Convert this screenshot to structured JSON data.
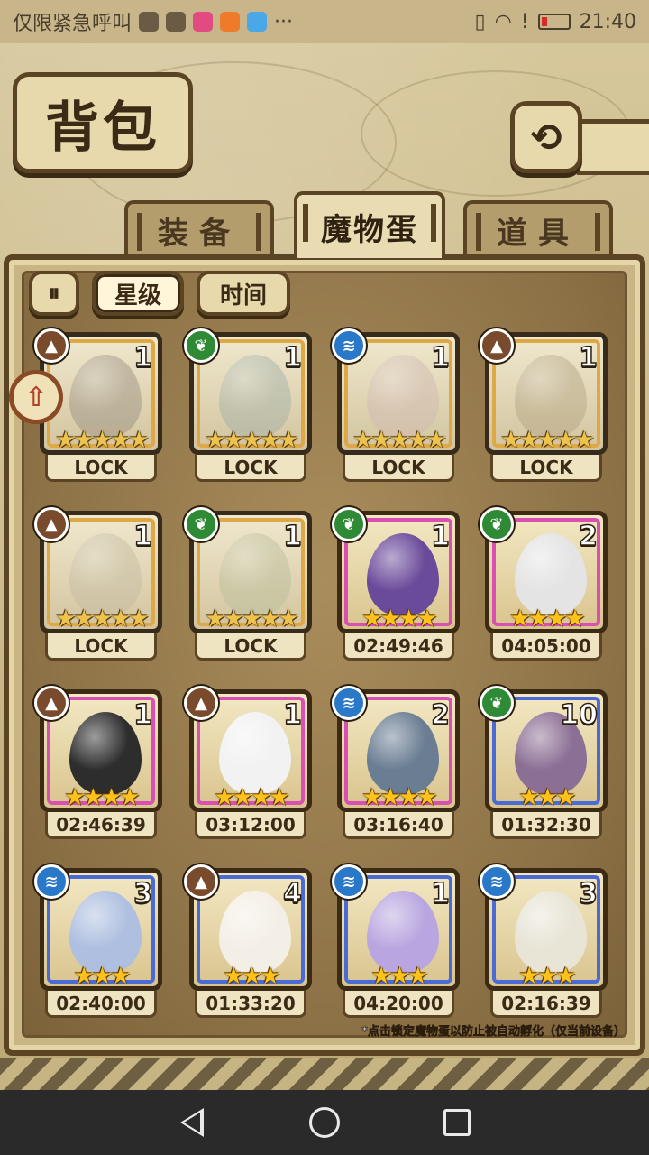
{
  "status_bar": {
    "carrier": "仅限紧急呼叫",
    "time": "21:40"
  },
  "header": {
    "title": "背包",
    "back_icon": "back-arrow-icon"
  },
  "tabs": [
    {
      "label": "装备",
      "active": false
    },
    {
      "label": "魔物蛋",
      "active": true
    },
    {
      "label": "道具",
      "active": false
    }
  ],
  "sort": {
    "toggle_icon": "pause-icon",
    "star_label": "星级",
    "time_label": "时间"
  },
  "eggs": [
    {
      "element": "earth",
      "count": "1",
      "stars": "★★★★★",
      "label": "LOCK",
      "rarity": "#f3a61c",
      "color": "#9a8c7a",
      "locked": true
    },
    {
      "element": "grass",
      "count": "1",
      "stars": "★★★★★",
      "label": "LOCK",
      "rarity": "#f3a61c",
      "color": "#9bb2a8",
      "locked": true
    },
    {
      "element": "water",
      "count": "1",
      "stars": "★★★★★",
      "label": "LOCK",
      "rarity": "#f3a61c",
      "color": "#d8b6b0",
      "locked": true
    },
    {
      "element": "earth",
      "count": "1",
      "stars": "★★★★★",
      "label": "LOCK",
      "rarity": "#f3a61c",
      "color": "#b9a477",
      "locked": true
    },
    {
      "element": "earth",
      "count": "1",
      "stars": "★★★★★",
      "label": "LOCK",
      "rarity": "#f3a61c",
      "color": "#c7bb98",
      "locked": true
    },
    {
      "element": "grass",
      "count": "1",
      "stars": "★★★★★",
      "label": "LOCK",
      "rarity": "#f3a61c",
      "color": "#b7c08e",
      "locked": true
    },
    {
      "element": "grass",
      "count": "1",
      "stars": "★★★★",
      "label": "02:49:46",
      "rarity": "#d94fb2",
      "color": "#6a4a9a",
      "locked": false
    },
    {
      "element": "grass",
      "count": "2",
      "stars": "★★★★",
      "label": "04:05:00",
      "rarity": "#d94fb2",
      "color": "#e4e4e4",
      "locked": false
    },
    {
      "element": "earth",
      "count": "1",
      "stars": "★★★★",
      "label": "02:46:39",
      "rarity": "#d94fb2",
      "color": "#2d2d2d",
      "locked": false
    },
    {
      "element": "earth",
      "count": "1",
      "stars": "★★★★",
      "label": "03:12:00",
      "rarity": "#d94fb2",
      "color": "#f2f2f2",
      "locked": false
    },
    {
      "element": "water",
      "count": "2",
      "stars": "★★★★",
      "label": "03:16:40",
      "rarity": "#d94fb2",
      "color": "#6a7d92",
      "locked": false
    },
    {
      "element": "grass",
      "count": "10",
      "stars": "★★★",
      "label": "01:32:30",
      "rarity": "#4a6bd6",
      "color": "#8c6f95",
      "locked": false
    },
    {
      "element": "water",
      "count": "3",
      "stars": "★★★",
      "label": "02:40:00",
      "rarity": "#4a6bd6",
      "color": "#aebfe0",
      "locked": false
    },
    {
      "element": "earth",
      "count": "4",
      "stars": "★★★",
      "label": "01:33:20",
      "rarity": "#4a6bd6",
      "color": "#f4efe6",
      "locked": false
    },
    {
      "element": "water",
      "count": "1",
      "stars": "★★★",
      "label": "04:20:00",
      "rarity": "#4a6bd6",
      "color": "#b9a6e0",
      "locked": false
    },
    {
      "element": "water",
      "count": "3",
      "stars": "★★★",
      "label": "02:16:39",
      "rarity": "#4a6bd6",
      "color": "#e8e4d6",
      "locked": false
    }
  ],
  "hint": "*点击锁定魔物蛋以防止被自动孵化（仅当前设备）"
}
